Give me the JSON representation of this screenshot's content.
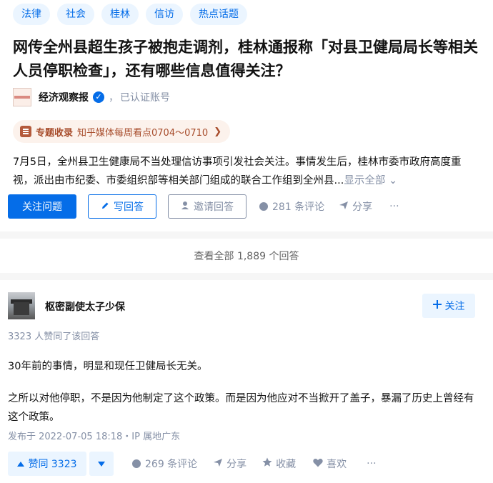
{
  "question": {
    "tags": [
      "法律",
      "社会",
      "桂林",
      "信访",
      "热点话题"
    ],
    "title": "网传全州县超生孩子被抱走调剂，桂林通报称「对县卫健局局长等相关人员停职检查」，还有哪些信息值得关注？",
    "author": {
      "name": "经济观察报",
      "separator": "，",
      "status": "已认证账号",
      "verified": true
    },
    "collection": {
      "label": "专题收录",
      "text": "知乎媒体每周看点0704～0710",
      "arrow": "❯"
    },
    "description": "7月5日，全州县卫生健康局不当处理信访事项引发社会关注。事情发生后，桂林市委市政府高度重视，派出由市纪委、市委组织部等相关部门组成的联合工作组到全州县...",
    "show_all": "显示全部",
    "show_all_icon": "⌄",
    "actions": {
      "follow": "关注问题",
      "write": "写回答",
      "invite": "邀请回答",
      "comments": "281 条评论",
      "share": "分享",
      "more": "···"
    }
  },
  "view_all": "查看全部 1,889 个回答",
  "answer": {
    "author": "枢密副使太子少保",
    "follow": "关注",
    "likes_note": "3323 人赞同了该回答",
    "paragraphs": [
      "30年前的事情，明显和现任卫健局长无关。",
      "之所以对他停职，不是因为他制定了这个政策。而是因为他应对不当掀开了盖子，暴漏了历史上曾经有这个政策。"
    ],
    "meta": "发布于 2022-07-05 18:18・IP 属地广东",
    "actions": {
      "upvote": "赞同 3323",
      "comments": "269 条评论",
      "share": "分享",
      "favorite": "收藏",
      "like": "喜欢",
      "more": "···"
    }
  },
  "colors": {
    "accent": "#056de8",
    "accent_bg": "#ebf5ff",
    "muted": "#8590a6",
    "collection": "#a74c2b"
  },
  "icons": [
    "verified-icon",
    "collection-icon",
    "pencil-icon",
    "invite-icon",
    "comment-icon",
    "share-icon",
    "more-icon",
    "plus-icon",
    "upvote-icon",
    "downvote-icon",
    "star-icon",
    "heart-icon"
  ]
}
